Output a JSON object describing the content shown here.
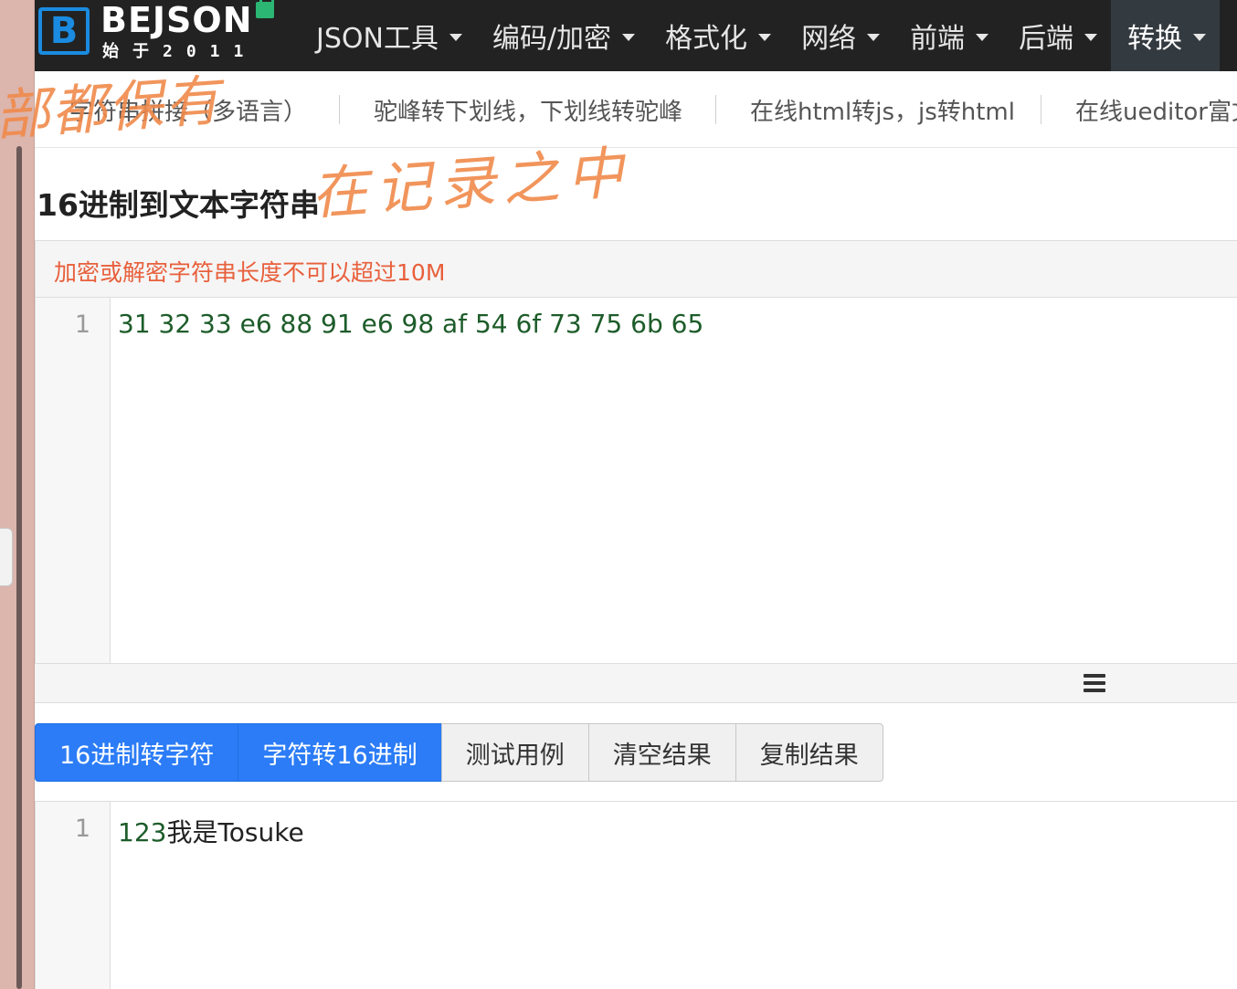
{
  "logo": {
    "box_letter": "B",
    "name": "BEJSON",
    "tagline": "始于2011"
  },
  "nav": {
    "items": [
      {
        "label": "JSON工具"
      },
      {
        "label": "编码/加密"
      },
      {
        "label": "格式化"
      },
      {
        "label": "网络"
      },
      {
        "label": "前端"
      },
      {
        "label": "后端"
      },
      {
        "label": "转换",
        "active": true
      }
    ]
  },
  "subnav": {
    "items": [
      {
        "label": "字符串拼接（多语言）"
      },
      {
        "label": "驼峰转下划线，下划线转驼峰"
      },
      {
        "label": "在线html转js，js转html"
      },
      {
        "label": "在线ueditor富文"
      }
    ]
  },
  "page": {
    "title": "16进制到文本字符串"
  },
  "input_panel": {
    "warning": "加密或解密字符串长度不可以超过10M",
    "line_number": "1",
    "content": "31 32 33 e6 88 91 e6 98 af 54 6f 73 75 6b 65"
  },
  "buttons": {
    "hex_to_str": "16进制转字符",
    "str_to_hex": "字符转16进制",
    "test_case": "测试用例",
    "clear": "清空结果",
    "copy": "复制结果"
  },
  "output_panel": {
    "line_number": "1",
    "content_digits": "123",
    "content_text": "我是Tosuke"
  },
  "annotations": {
    "note_1": "部都保有",
    "note_2": "在记录之中"
  },
  "colors": {
    "navbar": "#222222",
    "primary_button": "#2b7cf6",
    "warning_text": "#e8603c",
    "logo_blue": "#1a8be0",
    "annotation": "#f08a4b"
  }
}
